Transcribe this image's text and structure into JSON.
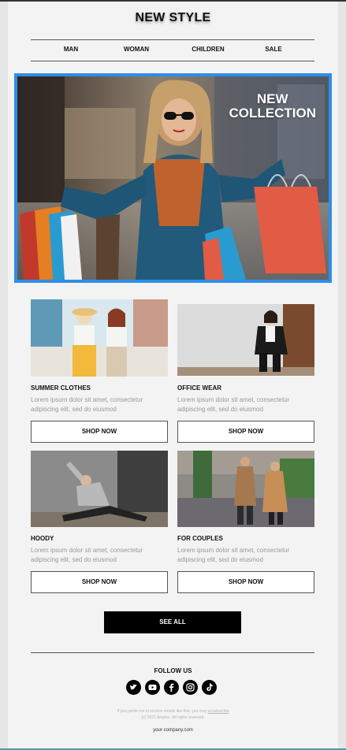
{
  "brand": {
    "title": "NEW STYLE"
  },
  "nav": {
    "items": [
      "MAN",
      "WOMAN",
      "CHILDREN",
      "SALE"
    ]
  },
  "hero": {
    "line1": "NEW",
    "line2": "COLLECTION"
  },
  "products": [
    {
      "title": "SUMMER CLOTHES",
      "desc": "Lorem ipsum dolor sit amet, consectetur adipiscing elit, sed do eiusmod",
      "button": "SHOP NOW"
    },
    {
      "title": "OFFICE WEAR",
      "desc": "Lorem ipsum dolor sit amet, consectetur adipiscing elit, sed do eiusmod",
      "button": "SHOP NOW"
    },
    {
      "title": "HOODY",
      "desc": "Lorem ipsum dolor sit amet, consectetur adipiscing elit, sed do eiusmod",
      "button": "SHOP NOW"
    },
    {
      "title": "FOR COUPLES",
      "desc": "Lorem ipsum dolor sit amet, consectetur adipiscing elit, sed do eiusmod",
      "button": "SHOP NOW"
    }
  ],
  "cta": {
    "see_all": "SEE ALL"
  },
  "footer": {
    "follow": "FOLLOW US",
    "socials": [
      "twitter-icon",
      "youtube-icon",
      "facebook-icon",
      "instagram-icon",
      "tiktok-icon"
    ],
    "notice_prefix": "If you prefer not to receive emails like this, you may",
    "unsubscribe": "unsubscribe",
    "copyright": "(c) 2021 Amplex. All rights reserved.",
    "domain": "your-company.com"
  },
  "colors": {
    "accent": "#2e8ee8",
    "button_dark": "#000000",
    "background": "#f3f3f3"
  }
}
